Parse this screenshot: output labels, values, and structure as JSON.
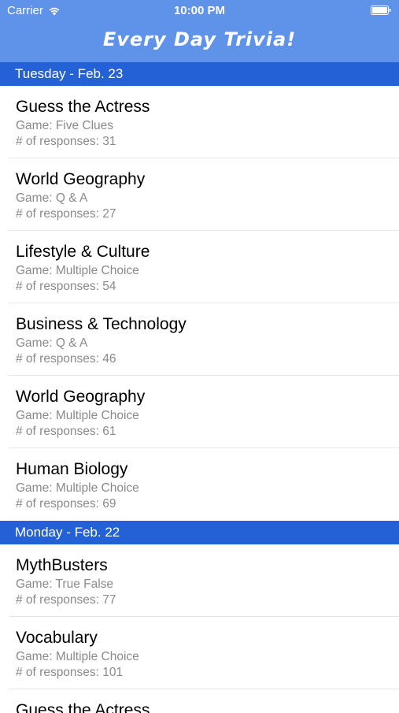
{
  "status_bar": {
    "carrier": "Carrier",
    "time": "10:00 PM"
  },
  "app": {
    "title": "Every Day Trivia!",
    "header_color": "#5f93ea",
    "section_color": "#2460d6"
  },
  "sections": [
    {
      "date": "Tuesday - Feb. 23",
      "items": [
        {
          "title": "Guess the Actress",
          "game": "Game: Five Clues",
          "responses": "# of responses: 31"
        },
        {
          "title": "World Geography",
          "game": "Game: Q & A",
          "responses": "# of responses: 27"
        },
        {
          "title": "Lifestyle & Culture",
          "game": "Game: Multiple Choice",
          "responses": "# of responses: 54"
        },
        {
          "title": "Business & Technology",
          "game": "Game: Q & A",
          "responses": "# of responses: 46"
        },
        {
          "title": "World Geography",
          "game": "Game: Multiple Choice",
          "responses": "# of responses: 61"
        },
        {
          "title": "Human Biology",
          "game": "Game: Multiple Choice",
          "responses": "# of responses: 69"
        }
      ]
    },
    {
      "date": "Monday - Feb. 22",
      "items": [
        {
          "title": "MythBusters",
          "game": "Game: True False",
          "responses": "# of responses: 77"
        },
        {
          "title": "Vocabulary",
          "game": "Game: Multiple Choice",
          "responses": "# of responses: 101"
        }
      ]
    }
  ],
  "partial_row_title": "Guess the Actress"
}
